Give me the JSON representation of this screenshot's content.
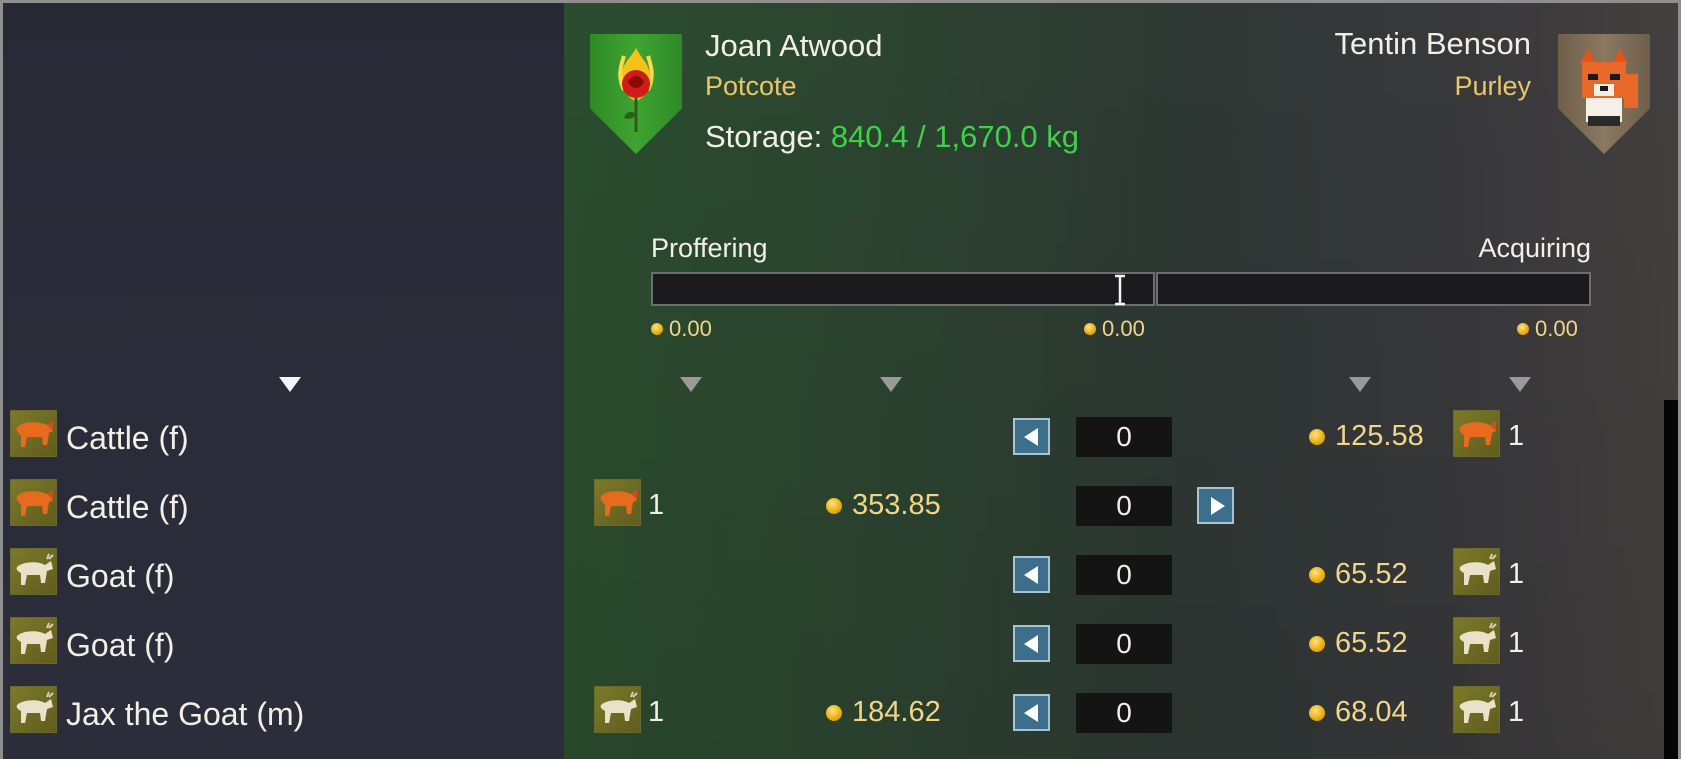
{
  "trader_left": {
    "name": "Joan Atwood",
    "place": "Potcote",
    "storage_label": "Storage:",
    "storage_value": "840.4 / 1,670.0 kg"
  },
  "trader_right": {
    "name": "Tentin Benson",
    "place": "Purley"
  },
  "balance": {
    "proffering_label": "Proffering",
    "acquiring_label": "Acquiring",
    "left_value": "0.00",
    "center_value": "0.00",
    "right_value": "0.00"
  },
  "rows": [
    {
      "name": "Cattle (f)",
      "icon": "cow-icon",
      "left_count": "",
      "left_price": "",
      "qty": "0",
      "arrow": "left",
      "right_price": "125.58",
      "right_count": "1"
    },
    {
      "name": "Cattle (f)",
      "icon": "cow-icon",
      "left_count": "1",
      "left_price": "353.85",
      "qty": "0",
      "arrow": "right",
      "right_price": "",
      "right_count": ""
    },
    {
      "name": "Goat (f)",
      "icon": "goat-icon",
      "left_count": "",
      "left_price": "",
      "qty": "0",
      "arrow": "left",
      "right_price": "65.52",
      "right_count": "1"
    },
    {
      "name": "Goat (f)",
      "icon": "goat-icon",
      "left_count": "",
      "left_price": "",
      "qty": "0",
      "arrow": "left",
      "right_price": "65.52",
      "right_count": "1"
    },
    {
      "name": "Jax the Goat (m)",
      "icon": "goat-icon",
      "left_count": "1",
      "left_price": "184.62",
      "qty": "0",
      "arrow": "left",
      "right_price": "68.04",
      "right_count": "1"
    }
  ],
  "colors": {
    "positive": "#3fd04a",
    "gold": "#e9c66a",
    "button": "#3d6f8c"
  }
}
